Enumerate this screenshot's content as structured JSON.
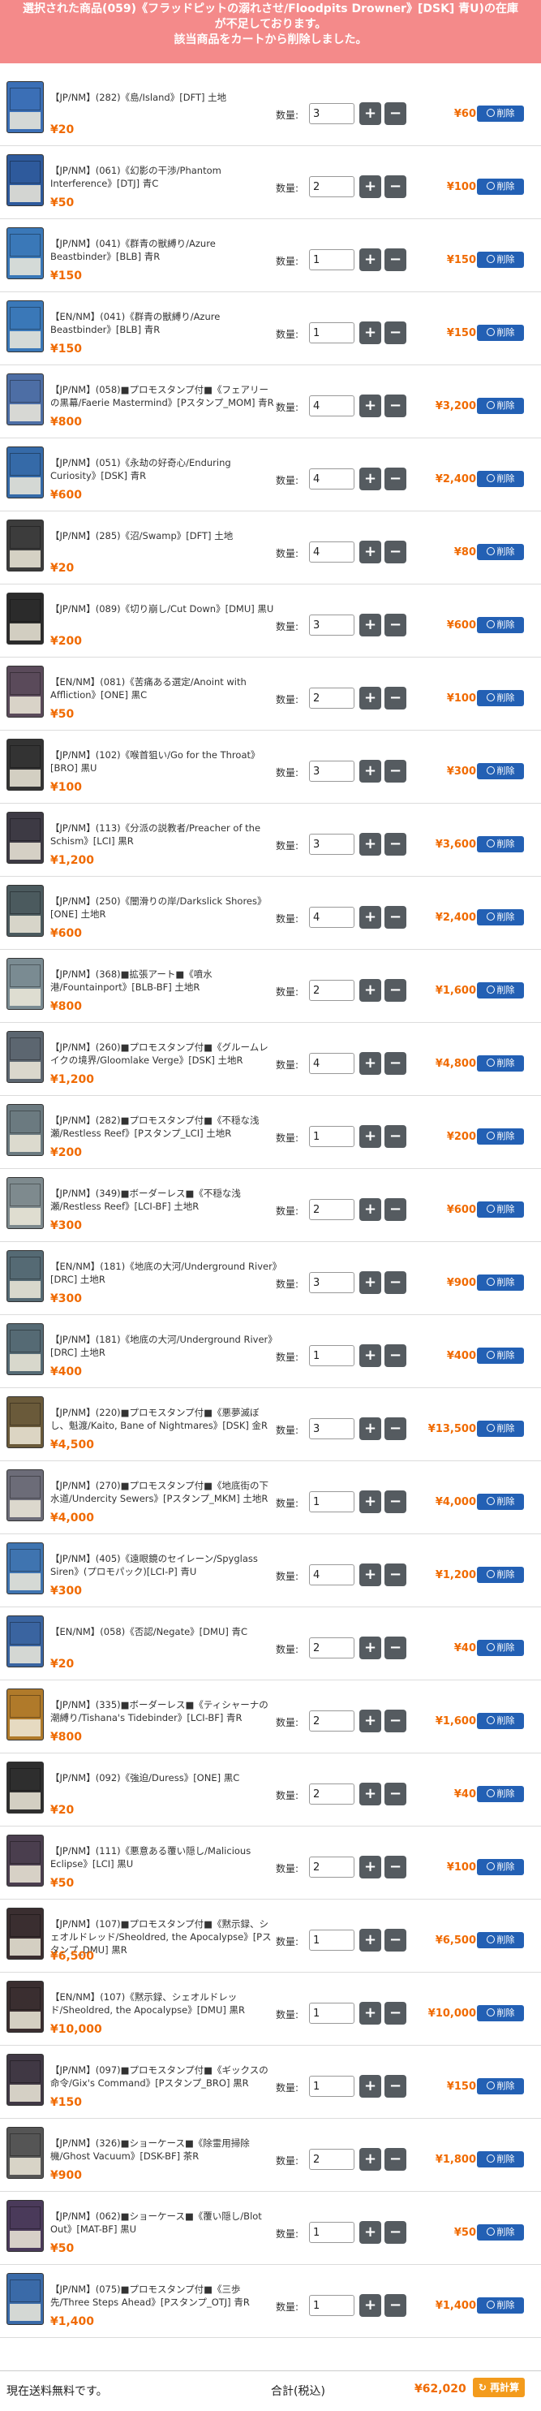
{
  "banner": {
    "line1": "選択された商品(059)《フラッドピットの溺れさせ/Floodpits Drowner》[DSK] 青U)の在庫",
    "line2": "が不足しております。",
    "line3": "該当商品をカートから削除しました。"
  },
  "labels": {
    "qty_label": "数量:",
    "plus": "+",
    "minus": "−",
    "delete": "削除"
  },
  "items": [
    {
      "name": "【JP/NM】(282)《島/Island》[DFT] 土地",
      "price": "¥20",
      "qty": "3",
      "subtotal": "¥60",
      "color": "#3b6fb6"
    },
    {
      "name": "【JP/NM】(061)《幻影の干渉/Phantom Interference》[DTJ] 青C",
      "price": "¥50",
      "qty": "2",
      "subtotal": "¥100",
      "color": "#2e5a9c"
    },
    {
      "name": "【JP/NM】(041)《群青の獣縛り/Azure Beastbinder》[BLB] 青R",
      "price": "¥150",
      "qty": "1",
      "subtotal": "¥150",
      "color": "#3a78b8"
    },
    {
      "name": "【EN/NM】(041)《群青の獣縛り/Azure Beastbinder》[BLB] 青R",
      "price": "¥150",
      "qty": "1",
      "subtotal": "¥150",
      "color": "#3a78b8"
    },
    {
      "name": "【JP/NM】(058)■プロモスタンプ付■《フェアリーの黒幕/Faerie Mastermind》[Pスタンプ_MOM] 青R",
      "price": "¥800",
      "qty": "4",
      "subtotal": "¥3,200",
      "color": "#4d6ea5"
    },
    {
      "name": "【JP/NM】(051)《永劫の好奇心/Enduring Curiosity》[DSK] 青R",
      "price": "¥600",
      "qty": "4",
      "subtotal": "¥2,400",
      "color": "#356aa8"
    },
    {
      "name": "【JP/NM】(285)《沼/Swamp》[DFT] 土地",
      "price": "¥20",
      "qty": "4",
      "subtotal": "¥80",
      "color": "#3c3c3c"
    },
    {
      "name": "【JP/NM】(089)《切り崩し/Cut Down》[DMU] 黒U",
      "price": "¥200",
      "qty": "3",
      "subtotal": "¥600",
      "color": "#2b2b2b"
    },
    {
      "name": "【EN/NM】(081)《苦痛ある選定/Anoint with Affliction》[ONE] 黒C",
      "price": "¥50",
      "qty": "2",
      "subtotal": "¥100",
      "color": "#5a4a5a"
    },
    {
      "name": "【JP/NM】(102)《喉首狙い/Go for the Throat》[BRO] 黒U",
      "price": "¥100",
      "qty": "3",
      "subtotal": "¥300",
      "color": "#333333"
    },
    {
      "name": "【JP/NM】(113)《分派の説教者/Preacher of the Schism》[LCI] 黒R",
      "price": "¥1,200",
      "qty": "3",
      "subtotal": "¥3,600",
      "color": "#3d3a44"
    },
    {
      "name": "【JP/NM】(250)《闇滑りの岸/Darkslick Shores》[ONE] 土地R",
      "price": "¥600",
      "qty": "4",
      "subtotal": "¥2,400",
      "color": "#4b5a5e"
    },
    {
      "name": "【JP/NM】(368)■拡張アート■《噴水港/Fountainport》[BLB-BF] 土地R",
      "price": "¥800",
      "qty": "2",
      "subtotal": "¥1,600",
      "color": "#7a8b92"
    },
    {
      "name": "【JP/NM】(260)■プロモスタンプ付■《グルームレイクの境界/Gloomlake Verge》[DSK] 土地R",
      "price": "¥1,200",
      "qty": "4",
      "subtotal": "¥4,800",
      "color": "#5c6670"
    },
    {
      "name": "【JP/NM】(282)■プロモスタンプ付■《不穏な浅瀬/Restless Reef》[Pスタンプ_LCI] 土地R",
      "price": "¥200",
      "qty": "1",
      "subtotal": "¥200",
      "color": "#6b7a80"
    },
    {
      "name": "【JP/NM】(349)■ボーダーレス■《不穏な浅瀬/Restless Reef》[LCI-BF] 土地R",
      "price": "¥300",
      "qty": "2",
      "subtotal": "¥600",
      "color": "#7e8a8e"
    },
    {
      "name": "【EN/NM】(181)《地底の大河/Underground River》[DRC] 土地R",
      "price": "¥300",
      "qty": "3",
      "subtotal": "¥900",
      "color": "#556a74"
    },
    {
      "name": "【JP/NM】(181)《地底の大河/Underground River》[DRC] 土地R",
      "price": "¥400",
      "qty": "1",
      "subtotal": "¥400",
      "color": "#556a74"
    },
    {
      "name": "【JP/NM】(220)■プロモスタンプ付■《悪夢滅ぼし、魁渡/Kaito, Bane of Nightmares》[DSK] 金R",
      "price": "¥4,500",
      "qty": "3",
      "subtotal": "¥13,500",
      "color": "#6a5a3a"
    },
    {
      "name": "【JP/NM】(270)■プロモスタンプ付■《地底街の下水道/Undercity Sewers》[Pスタンプ_MKM] 土地R",
      "price": "¥4,000",
      "qty": "1",
      "subtotal": "¥4,000",
      "color": "#6c6c78"
    },
    {
      "name": "【JP/NM】(405)《遠眼鏡のセイレーン/Spyglass Siren》(プロモパック)[LCI-P] 青U",
      "price": "¥300",
      "qty": "4",
      "subtotal": "¥1,200",
      "color": "#3f74b0"
    },
    {
      "name": "【EN/NM】(058)《否認/Negate》[DMU] 青C",
      "price": "¥20",
      "qty": "2",
      "subtotal": "¥40",
      "color": "#3a64a0"
    },
    {
      "name": "【JP/NM】(335)■ボーダーレス■《ティシャーナの潮縛り/Tishana's Tidebinder》[LCI-BF] 青R",
      "price": "¥800",
      "qty": "2",
      "subtotal": "¥1,600",
      "color": "#b07a2a"
    },
    {
      "name": "【JP/NM】(092)《強迫/Duress》[ONE] 黒C",
      "price": "¥20",
      "qty": "2",
      "subtotal": "¥40",
      "color": "#2e2e2e"
    },
    {
      "name": "【JP/NM】(111)《悪意ある覆い隠し/Malicious Eclipse》[LCI] 黒U",
      "price": "¥50",
      "qty": "2",
      "subtotal": "¥100",
      "color": "#4a3e4e"
    },
    {
      "name": "【JP/NM】(107)■プロモスタンプ付■《黙示録、シェオルドレッド/Sheoldred, the Apocalypse》[Pスタンプ_DMU] 黒R",
      "price": "¥6,500",
      "qty": "1",
      "subtotal": "¥6,500",
      "color": "#3a2e30"
    },
    {
      "name": "【EN/NM】(107)《黙示録、シェオルドレッド/Sheoldred, the Apocalypse》[DMU] 黒R",
      "price": "¥10,000",
      "qty": "1",
      "subtotal": "¥10,000",
      "color": "#3a2e30"
    },
    {
      "name": "【JP/NM】(097)■プロモスタンプ付■《ギックスの命令/Gix's Command》[Pスタンプ_BRO] 黒R",
      "price": "¥150",
      "qty": "1",
      "subtotal": "¥150",
      "color": "#403844"
    },
    {
      "name": "【JP/NM】(326)■ショーケース■《除霊用掃除機/Ghost Vacuum》[DSK-BF] 茶R",
      "price": "¥900",
      "qty": "2",
      "subtotal": "¥1,800",
      "color": "#555555"
    },
    {
      "name": "【JP/NM】(062)■ショーケース■《覆い隠し/Blot Out》[MAT-BF] 黒U",
      "price": "¥50",
      "qty": "1",
      "subtotal": "¥50",
      "color": "#4a3a5a"
    },
    {
      "name": "【JP/NM】(075)■プロモスタンプ付■《三歩先/Three Steps Ahead》[Pスタンプ_OTJ] 青R",
      "price": "¥1,400",
      "qty": "1",
      "subtotal": "¥1,400",
      "color": "#3a6aa8"
    }
  ],
  "footer": {
    "shipping_text": "現在送料無料です。",
    "total_label": "合計(税込)",
    "total_value": "¥62,020",
    "recalc_label": "再計算"
  }
}
